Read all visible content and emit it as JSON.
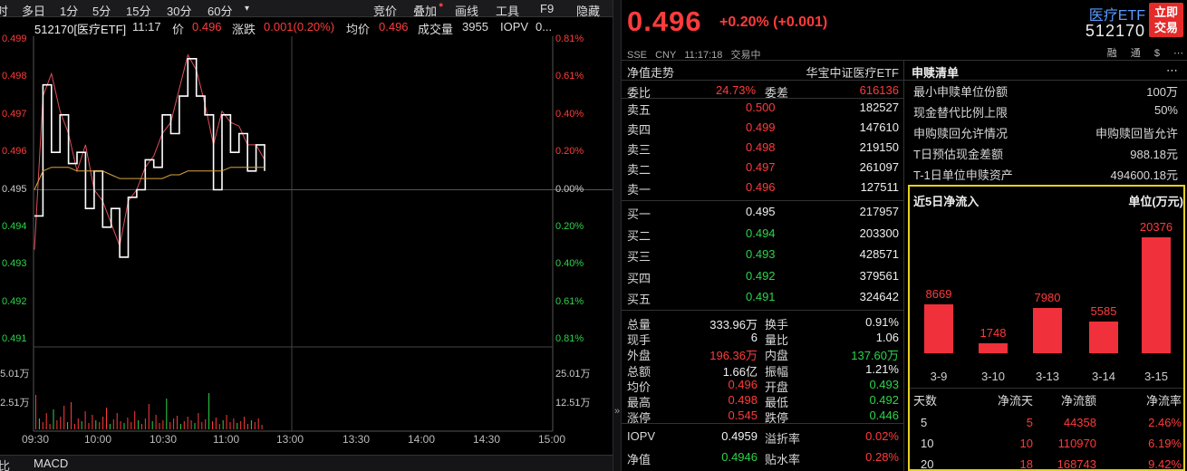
{
  "toolbar": {
    "left_clip": "时",
    "multi_day": "多日",
    "periods": [
      "1分",
      "5分",
      "15分",
      "30分",
      "60分"
    ],
    "more": "▾",
    "bidding": "竞价",
    "overlay": "叠加",
    "draw_line": "画线",
    "tools": "工具",
    "f9": "F9",
    "hide": "隐藏"
  },
  "infoline": {
    "code_name": "512170[医疗ETF]",
    "time": "11:17",
    "price_label": "价",
    "price": "0.496",
    "change_label": "涨跌",
    "change": "0.001(0.20%)",
    "avg_label": "均价",
    "avg": "0.496",
    "volume_label": "成交量",
    "volume": "3955",
    "iopv_label": "IOPV",
    "iopv": "0..."
  },
  "chart_data": {
    "type": "line",
    "xlabel": "",
    "ylabel": "",
    "x_ticks": [
      "09:30",
      "10:00",
      "10:30",
      "11:00",
      "13:00",
      "13:30",
      "14:00",
      "14:30",
      "15:00"
    ],
    "y_ticks_left": [
      "0.499",
      "0.498",
      "0.497",
      "0.496",
      "0.495",
      "0.494",
      "0.493",
      "0.492",
      "0.491"
    ],
    "y_ticks_right": [
      "0.81%",
      "0.61%",
      "0.40%",
      "0.20%",
      "0.00%",
      "0.20%",
      "0.40%",
      "0.61%",
      "0.81%"
    ],
    "ylim": [
      0.4909,
      0.4991
    ],
    "prev_close": 0.495,
    "volume_ticks": [
      "25.01万",
      "12.51万"
    ],
    "series": [
      {
        "values": [
          0.4934,
          0.4975,
          0.4981,
          0.4971,
          0.4965,
          0.4955,
          0.4962,
          0.495,
          0.4947,
          0.4941,
          0.4935,
          0.4947,
          0.495,
          0.4956,
          0.4959,
          0.4965,
          0.4968,
          0.4977,
          0.4986,
          0.4982,
          0.4973,
          0.4962,
          0.4971,
          0.4968,
          0.4967,
          0.4962,
          0.4962,
          0.4958
        ]
      },
      {
        "values": [
          0.4943,
          0.4978,
          0.496,
          0.497,
          0.4957,
          0.496,
          0.4945,
          0.4955,
          0.494,
          0.4945,
          0.4932,
          0.4948,
          0.495,
          0.4958,
          0.4956,
          0.497,
          0.4965,
          0.4975,
          0.4985,
          0.4975,
          0.497,
          0.495,
          0.497,
          0.496,
          0.4965,
          0.4955,
          0.4962,
          0.4955
        ]
      },
      {
        "values": [
          0.495,
          0.4955,
          0.4956,
          0.4956,
          0.4956,
          0.4955,
          0.4955,
          0.4955,
          0.4955,
          0.4954,
          0.4953,
          0.4953,
          0.4953,
          0.4953,
          0.4953,
          0.4953,
          0.4954,
          0.4954,
          0.4955,
          0.4955,
          0.4955,
          0.4955,
          0.4955,
          0.4956,
          0.4956,
          0.4956,
          0.4956,
          0.4956
        ]
      }
    ]
  },
  "bottom_tabs": {
    "left": "比",
    "macd": "MACD"
  },
  "sep_arrow": "»",
  "quote": {
    "price": "0.496",
    "change": "+0.20% (+0.001)",
    "exchange": "SSE",
    "currency": "CNY",
    "time": "11:17:18",
    "status": "交易中",
    "name": "医疗ETF",
    "code": "512170",
    "trade_button": "立即交易",
    "icons": [
      "融",
      "通",
      "$",
      "⋯"
    ]
  },
  "orderbook": {
    "nav_trend_label": "净值走势",
    "index_name": "华宝中证医疗ETF",
    "weibi_label": "委比",
    "weibi": "24.73%",
    "weicha_label": "委差",
    "weicha": "616136",
    "asks": [
      {
        "label": "卖五",
        "price": "0.500",
        "vol": "182527",
        "color": "red"
      },
      {
        "label": "卖四",
        "price": "0.499",
        "vol": "147610",
        "color": "red"
      },
      {
        "label": "卖三",
        "price": "0.498",
        "vol": "219150",
        "color": "red"
      },
      {
        "label": "卖二",
        "price": "0.497",
        "vol": "261097",
        "color": "red"
      },
      {
        "label": "卖一",
        "price": "0.496",
        "vol": "127511",
        "color": "red"
      }
    ],
    "bids": [
      {
        "label": "买一",
        "price": "0.495",
        "vol": "217957",
        "color": "white"
      },
      {
        "label": "买二",
        "price": "0.494",
        "vol": "203300",
        "color": "green"
      },
      {
        "label": "买三",
        "price": "0.493",
        "vol": "428571",
        "color": "green"
      },
      {
        "label": "买四",
        "price": "0.492",
        "vol": "379561",
        "color": "green"
      },
      {
        "label": "买五",
        "price": "0.491",
        "vol": "324642",
        "color": "green"
      }
    ]
  },
  "stats": [
    {
      "l1": "总量",
      "v1": "333.96万",
      "c1": "white",
      "l2": "换手",
      "v2": "0.91%",
      "c2": "white"
    },
    {
      "l1": "现手",
      "v1": "6",
      "c1": "white",
      "l2": "量比",
      "v2": "1.06",
      "c2": "white"
    },
    {
      "l1": "外盘",
      "v1": "196.36万",
      "c1": "red",
      "l2": "内盘",
      "v2": "137.60万",
      "c2": "green"
    },
    {
      "l1": "总额",
      "v1": "1.66亿",
      "c1": "white",
      "l2": "振幅",
      "v2": "1.21%",
      "c2": "white"
    },
    {
      "l1": "均价",
      "v1": "0.496",
      "c1": "red",
      "l2": "开盘",
      "v2": "0.493",
      "c2": "green"
    },
    {
      "l1": "最高",
      "v1": "0.498",
      "c1": "red",
      "l2": "最低",
      "v2": "0.492",
      "c2": "green"
    },
    {
      "l1": "涨停",
      "v1": "0.545",
      "c1": "red",
      "l2": "跌停",
      "v2": "0.446",
      "c2": "green"
    }
  ],
  "nav_stats": [
    {
      "l1": "IOPV",
      "v1": "0.4959",
      "c1": "white",
      "l2": "溢折率",
      "v2": "0.02%",
      "c2": "red"
    },
    {
      "l1": "净值",
      "v1": "0.4946",
      "c1": "green",
      "l2": "贴水率",
      "v2": "0.28%",
      "c2": "red"
    }
  ],
  "subscription": {
    "title": "申赎清单",
    "more": "⋯",
    "items": [
      {
        "label": "最小申赎单位份额",
        "value": "100万"
      },
      {
        "label": "现金替代比例上限",
        "value": "50%"
      },
      {
        "label": "申购赎回允许情况",
        "value": "申购赎回皆允许"
      },
      {
        "label": "T日预估现金差额",
        "value": "988.18元"
      },
      {
        "label": "T-1日单位申赎资产",
        "value": "494600.18元"
      }
    ]
  },
  "netflow": {
    "title": "近5日净流入",
    "unit": "单位(万元)",
    "bars": [
      {
        "date": "3-9",
        "value": 8669
      },
      {
        "date": "3-10",
        "value": 1748
      },
      {
        "date": "3-13",
        "value": 7980
      },
      {
        "date": "3-14",
        "value": 5585
      },
      {
        "date": "3-15",
        "value": 20376
      }
    ],
    "table_headers": [
      "天数",
      "净流天",
      "净流额",
      "净流率"
    ],
    "table_rows": [
      [
        "5",
        "5",
        "44358",
        "2.46%"
      ],
      [
        "10",
        "10",
        "110970",
        "6.19%"
      ],
      [
        "20",
        "18",
        "168743",
        "9.42%"
      ]
    ]
  }
}
